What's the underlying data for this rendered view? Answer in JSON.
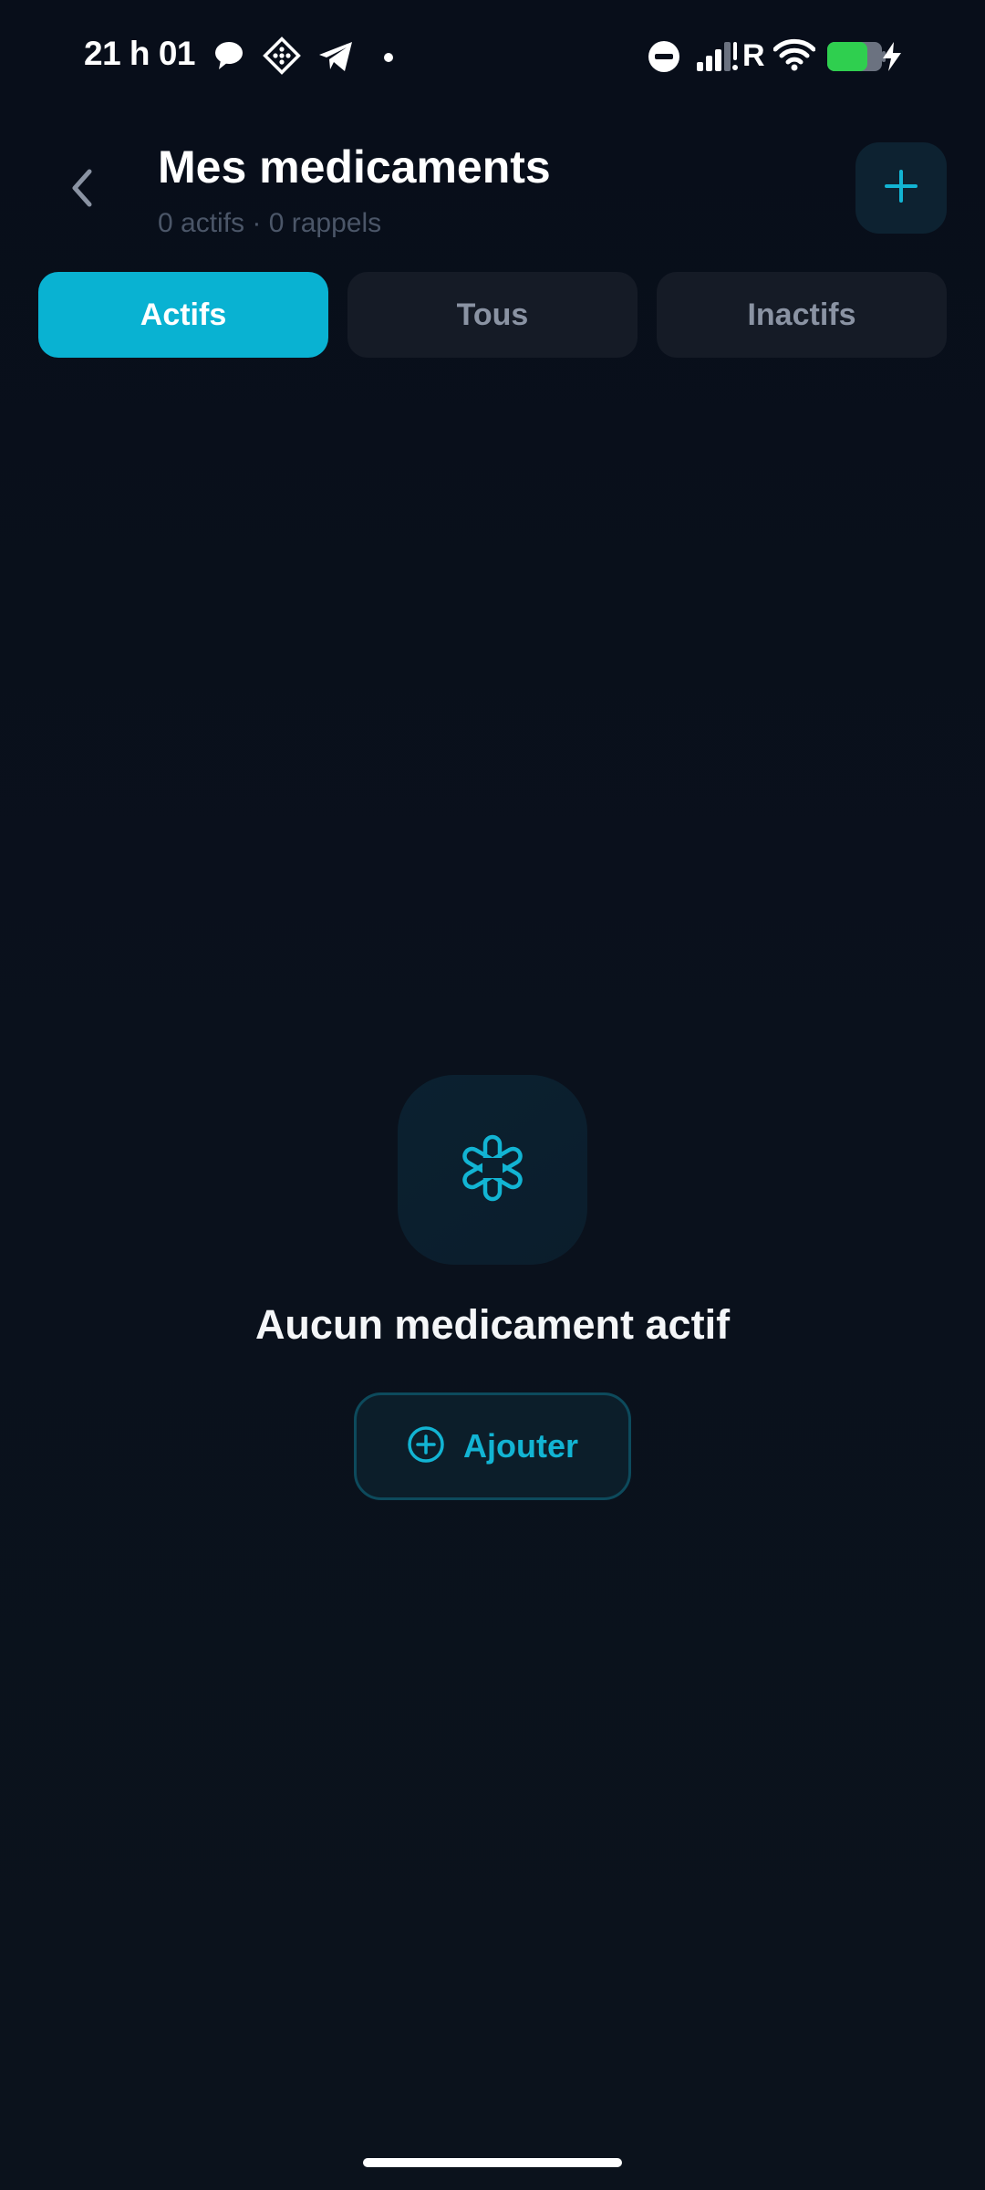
{
  "status_bar": {
    "time": "21 h 01",
    "network_label": "R",
    "icons": [
      "chat-bubble-icon",
      "crypto-app-icon",
      "telegram-icon",
      "notification-dot-icon",
      "do-not-disturb-icon",
      "signal-icon",
      "wifi-icon",
      "battery-icon",
      "charging-bolt-icon"
    ]
  },
  "header": {
    "title": "Mes medicaments",
    "subtitle": "0 actifs · 0 rappels",
    "back_icon": "chevron-left-icon",
    "add_icon": "plus-icon"
  },
  "tabs": [
    {
      "label": "Actifs",
      "active": true
    },
    {
      "label": "Tous",
      "active": false
    },
    {
      "label": "Inactifs",
      "active": false
    }
  ],
  "empty_state": {
    "icon": "medical-asterisk-icon",
    "title": "Aucun medicament actif",
    "button_label": "Ajouter",
    "button_icon": "plus-circle-icon"
  },
  "colors": {
    "background": "#0a101b",
    "accent": "#09b2d2",
    "tab_inactive_bg": "#151b26",
    "subtitle": "#4b5668"
  }
}
